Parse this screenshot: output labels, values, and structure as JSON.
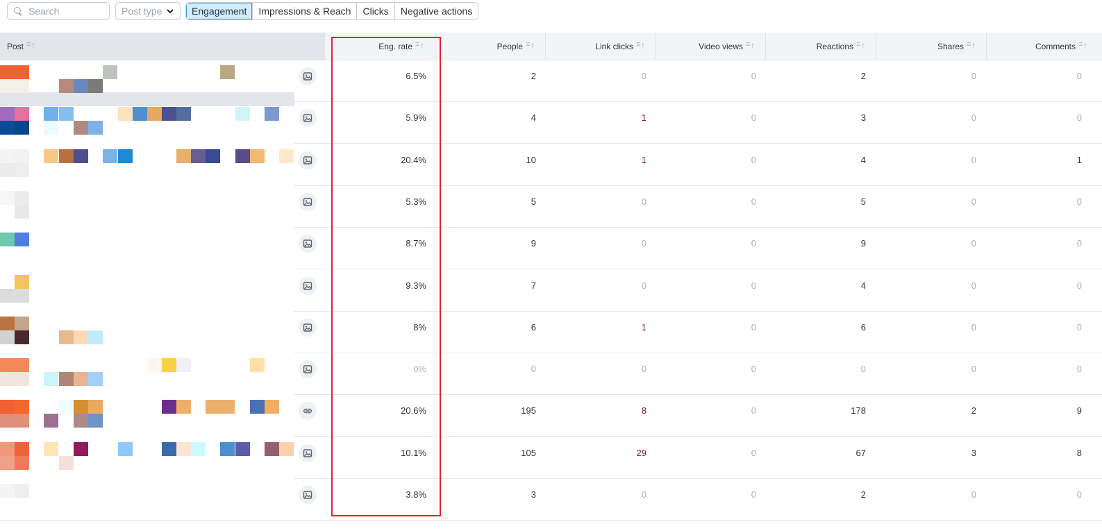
{
  "toolbar": {
    "search_placeholder": "Search",
    "post_type_label": "Post type",
    "tabs": [
      "Engagement",
      "Impressions & Reach",
      "Clicks",
      "Negative actions"
    ],
    "active_tab": "Engagement"
  },
  "table": {
    "columns": [
      "Post",
      "Eng. rate",
      "People",
      "Link clicks",
      "Video views",
      "Reactions",
      "Shares",
      "Comments"
    ],
    "rows": [
      {
        "type": "image-icon",
        "eng_rate": "6.5%",
        "people": "2",
        "link_clicks": "0",
        "video_views": "0",
        "reactions": "2",
        "shares": "0",
        "comments": "0"
      },
      {
        "type": "image-icon",
        "eng_rate": "5.9%",
        "people": "4",
        "link_clicks": "1",
        "video_views": "0",
        "reactions": "3",
        "shares": "0",
        "comments": "0"
      },
      {
        "type": "image-icon",
        "eng_rate": "20.4%",
        "people": "10",
        "link_clicks": "1",
        "video_views": "0",
        "reactions": "4",
        "shares": "0",
        "comments": "1"
      },
      {
        "type": "image-icon",
        "eng_rate": "5.3%",
        "people": "5",
        "link_clicks": "0",
        "video_views": "0",
        "reactions": "5",
        "shares": "0",
        "comments": "0"
      },
      {
        "type": "image-icon",
        "eng_rate": "8.7%",
        "people": "9",
        "link_clicks": "0",
        "video_views": "0",
        "reactions": "9",
        "shares": "0",
        "comments": "0"
      },
      {
        "type": "image-icon",
        "eng_rate": "9.3%",
        "people": "7",
        "link_clicks": "0",
        "video_views": "0",
        "reactions": "4",
        "shares": "0",
        "comments": "0"
      },
      {
        "type": "image-icon",
        "eng_rate": "8%",
        "people": "6",
        "link_clicks": "1",
        "video_views": "0",
        "reactions": "6",
        "shares": "0",
        "comments": "0"
      },
      {
        "type": "image-icon",
        "eng_rate": "0%",
        "people": "0",
        "link_clicks": "0",
        "video_views": "0",
        "reactions": "0",
        "shares": "0",
        "comments": "0"
      },
      {
        "type": "link-icon",
        "eng_rate": "20.6%",
        "people": "195",
        "link_clicks": "8",
        "video_views": "0",
        "reactions": "178",
        "shares": "2",
        "comments": "9"
      },
      {
        "type": "image-icon",
        "eng_rate": "10.1%",
        "people": "105",
        "link_clicks": "29",
        "video_views": "0",
        "reactions": "67",
        "shares": "3",
        "comments": "8"
      },
      {
        "type": "image-icon",
        "eng_rate": "3.8%",
        "people": "3",
        "link_clicks": "0",
        "video_views": "0",
        "reactions": "2",
        "shares": "0",
        "comments": "0"
      }
    ]
  },
  "colors": {
    "active_tab_bg": "#d7ecfb",
    "active_tab_border": "#3d9bd8",
    "highlight": "#e0232f",
    "zero_text": "#a9adb6",
    "link_clicks_positive": "#8a1530"
  }
}
